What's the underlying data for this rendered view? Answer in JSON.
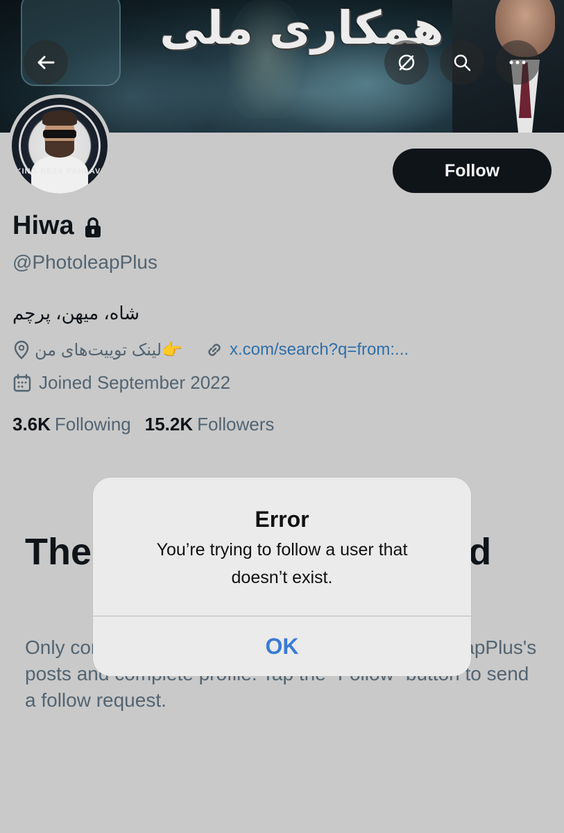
{
  "banner": {
    "title": "همکاری ملی",
    "buttons": {
      "back": "back-arrow-icon",
      "grok": "grok-icon",
      "search": "search-icon",
      "more": "more-icon"
    }
  },
  "avatar": {
    "text": "KING REZA PAHLAVI"
  },
  "follow_button": {
    "label": "Follow"
  },
  "profile": {
    "name": "Hiwa",
    "handle": "@PhotoleapPlus",
    "bio": "شاه، میهن، پرچم",
    "location": "👉لینک توییت‌های من",
    "website": "x.com/search?q=from:...",
    "joined": "Joined September 2022",
    "following_count": "3.6K",
    "following_label": "Following",
    "followers_count": "15.2K",
    "followers_label": "Followers"
  },
  "protected": {
    "heading": "These posts are protected",
    "body": "Only confirmed followers have access to @PhotoleapPlus's posts and complete profile. Tap the “Follow” button to send a follow request."
  },
  "alert": {
    "title": "Error",
    "message": "You’re trying to follow a user that doesn’t exist.",
    "ok_label": "OK"
  },
  "colors": {
    "background": "#c9c9c9",
    "text_primary": "#0f1419",
    "text_secondary": "#536471",
    "link": "#2f6fa8",
    "alert_button": "#3a7bd5",
    "follow_button_bg": "#0f1419"
  }
}
